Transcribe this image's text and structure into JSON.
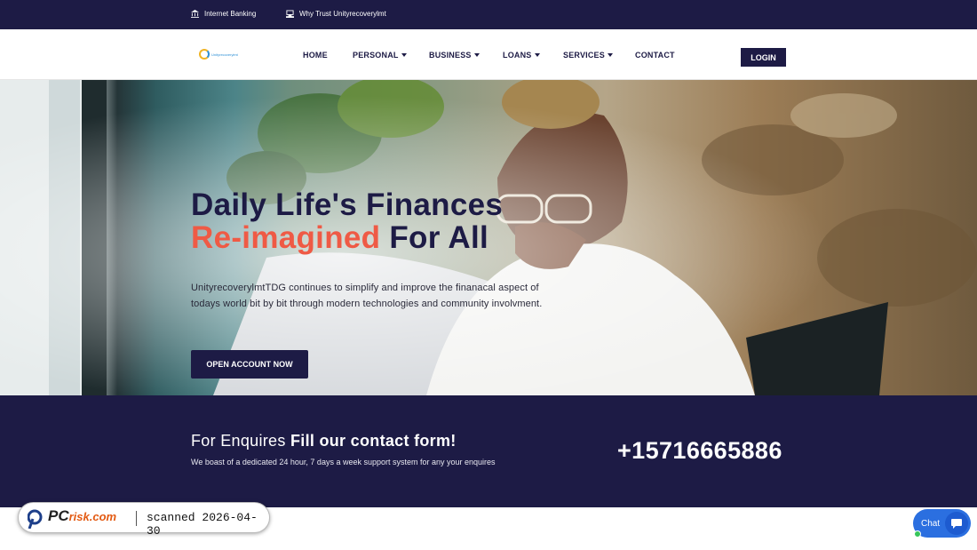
{
  "topbar": {
    "internet_banking": "Internet Banking",
    "why_trust": "Why Trust Unityrecoverylmt"
  },
  "logo": {
    "text": "Unityrecoverylmt"
  },
  "nav": {
    "items": [
      {
        "label": "HOME",
        "dropdown": false
      },
      {
        "label": "PERSONAL",
        "dropdown": true
      },
      {
        "label": "BUSINESS",
        "dropdown": true
      },
      {
        "label": "LOANS",
        "dropdown": true
      },
      {
        "label": "SERVICES",
        "dropdown": true
      },
      {
        "label": "CONTACT",
        "dropdown": false
      }
    ],
    "login": "LOGIN"
  },
  "hero": {
    "title_line1": "Daily Life's Finances",
    "title_accent": "Re-imagined",
    "title_line2_rest": "For All",
    "description": "UnityrecoverylmtTDG continues to simplify and improve the finanacal aspect of todays world bit by bit through modern technologies and community involvment.",
    "cta": "OPEN ACCOUNT NOW"
  },
  "contact_band": {
    "title_light": "For Enquires",
    "title_bold": "Fill our contact form!",
    "description": "We boast of a dedicated 24 hour, 7 days a week support system for any your enquires",
    "phone": "+15716665886"
  },
  "watermark": {
    "brand_pc": "PC",
    "brand_rest": "risk.com",
    "scan_text": "scanned 2026-04-30"
  },
  "chat": {
    "label": "Chat"
  },
  "colors": {
    "navy": "#1d1b45",
    "accent": "#ef5a45",
    "chat_blue": "#2b6fe0"
  }
}
